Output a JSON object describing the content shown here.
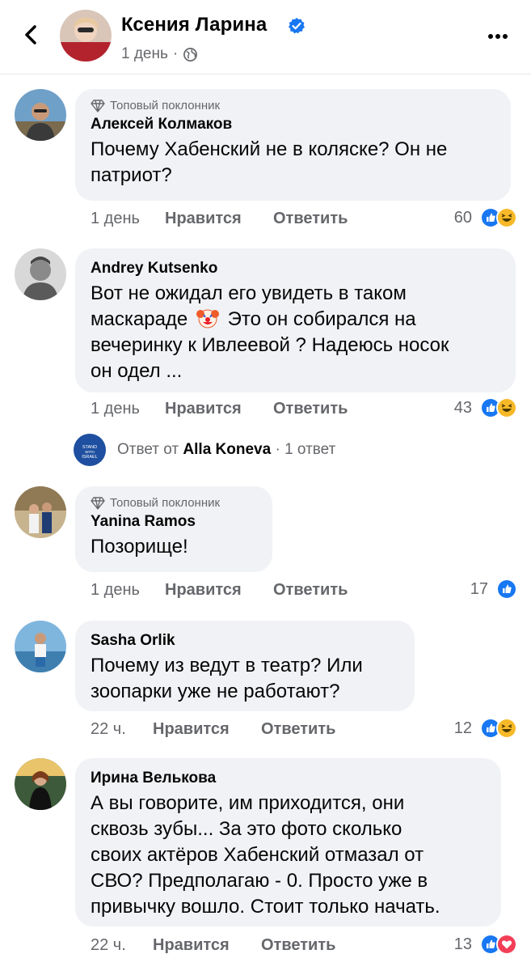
{
  "header": {
    "name": "Ксения Ларина",
    "time": "1 день",
    "dot": "·"
  },
  "actions_labels": {
    "like": "Нравится",
    "reply": "Ответить"
  },
  "comments": [
    {
      "badge": "Топовый поклонник",
      "author": "Алексей Колмаков",
      "text_lines": [
        "Почему Хабенский не в коляске? Он не",
        "патриот?"
      ],
      "time": "1 день",
      "reaction_count": "60",
      "reactions": [
        "like",
        "haha"
      ]
    },
    {
      "author": "Andrey Kutsenko",
      "text_lines": [
        "Вот не ожидал его увидеть в  таком",
        "маскараде",
        "Это он собирался на",
        "вечеринку к Ивлеевой ? Надеюсь носок",
        "он одел ..."
      ],
      "emoji": "clown-face",
      "time": "1 день",
      "reaction_count": "43",
      "reactions": [
        "like",
        "haha"
      ]
    },
    {
      "badge": "Топовый поклонник",
      "author": "Yanina Ramos",
      "text_lines": [
        "Позорище!"
      ],
      "time": "1 день",
      "reaction_count": "17",
      "reactions": [
        "like"
      ]
    },
    {
      "author": "Sasha Orlik",
      "text_lines": [
        "Почему из ведут в театр? Или",
        "зоопарки уже не работают?"
      ],
      "time": "22 ч.",
      "reaction_count": "12",
      "reactions": [
        "like",
        "haha"
      ]
    },
    {
      "author": "Ирина Велькова",
      "text_lines": [
        "А вы говорите, им приходится, они",
        "сквозь зубы... За это фото сколько",
        "своих актёров Хабенский отмазал от",
        "СВО? Предполагаю - 0. Просто уже в",
        "привычку вошло. Стоит только начать."
      ],
      "time": "22 ч.",
      "reaction_count": "13",
      "reactions": [
        "like",
        "love"
      ]
    }
  ],
  "reply": {
    "prefix": "Ответ от",
    "author": "Alla Koneva",
    "suffix": "· 1 ответ",
    "avatar_text": "STAND WITH ISRAEL"
  },
  "colors": {
    "like_blue": "#1877f2",
    "haha_yellow": "#f7b928",
    "love_red": "#f33e58",
    "bubble_bg": "#f0f2f5",
    "secondary_text": "#65676b"
  }
}
